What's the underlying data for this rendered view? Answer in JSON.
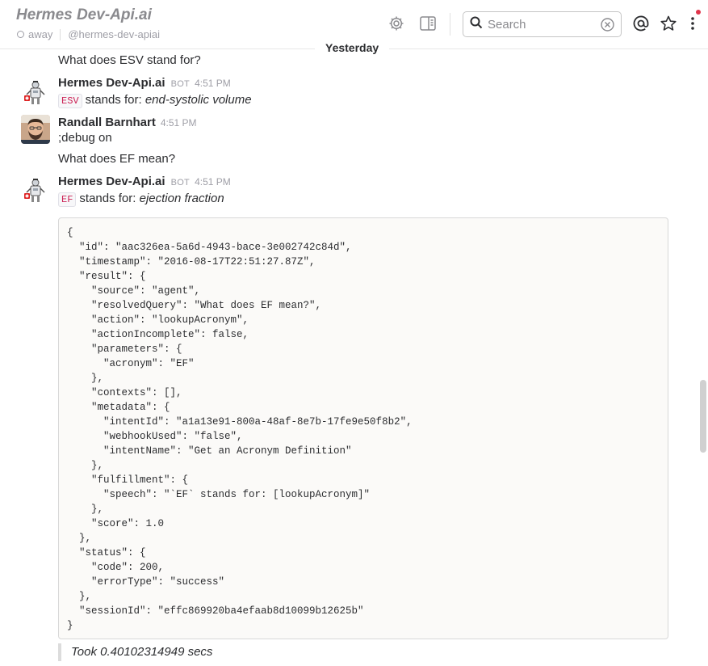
{
  "header": {
    "channel_title": "Hermes Dev-Api.ai",
    "presence": "away",
    "handle": "@hermes-dev-apiai",
    "search_placeholder": "Search"
  },
  "day_divider": "Yesterday",
  "messages": [
    {
      "text": "What does ESV stand for?"
    },
    {
      "sender": "Hermes Dev-Api.ai",
      "badge": "BOT",
      "time": "4:51 PM",
      "code": "ESV",
      "prefix": "stands for:",
      "value": "end-systolic volume"
    },
    {
      "sender": "Randall Barnhart",
      "time": "4:51 PM",
      "lines": [
        ";debug on",
        "What does EF mean?"
      ]
    },
    {
      "sender": "Hermes Dev-Api.ai",
      "badge": "BOT",
      "time": "4:51 PM",
      "code": "EF",
      "prefix": "stands for:",
      "value": "ejection fraction",
      "code_block": "{\n  \"id\": \"aac326ea-5a6d-4943-bace-3e002742c84d\",\n  \"timestamp\": \"2016-08-17T22:51:27.87Z\",\n  \"result\": {\n    \"source\": \"agent\",\n    \"resolvedQuery\": \"What does EF mean?\",\n    \"action\": \"lookupAcronym\",\n    \"actionIncomplete\": false,\n    \"parameters\": {\n      \"acronym\": \"EF\"\n    },\n    \"contexts\": [],\n    \"metadata\": {\n      \"intentId\": \"a1a13e91-800a-48af-8e7b-17fe9e50f8b2\",\n      \"webhookUsed\": \"false\",\n      \"intentName\": \"Get an Acronym Definition\"\n    },\n    \"fulfillment\": {\n      \"speech\": \"`EF` stands for: [lookupAcronym]\"\n    },\n    \"score\": 1.0\n  },\n  \"status\": {\n    \"code\": 200,\n    \"errorType\": \"success\"\n  },\n  \"sessionId\": \"effc869920ba4efaab8d10099b12625b\"\n}",
      "quote": "Took 0.40102314949 secs"
    }
  ],
  "colors": {
    "inline_code": "#cc2255",
    "notification": "#e0354b"
  }
}
